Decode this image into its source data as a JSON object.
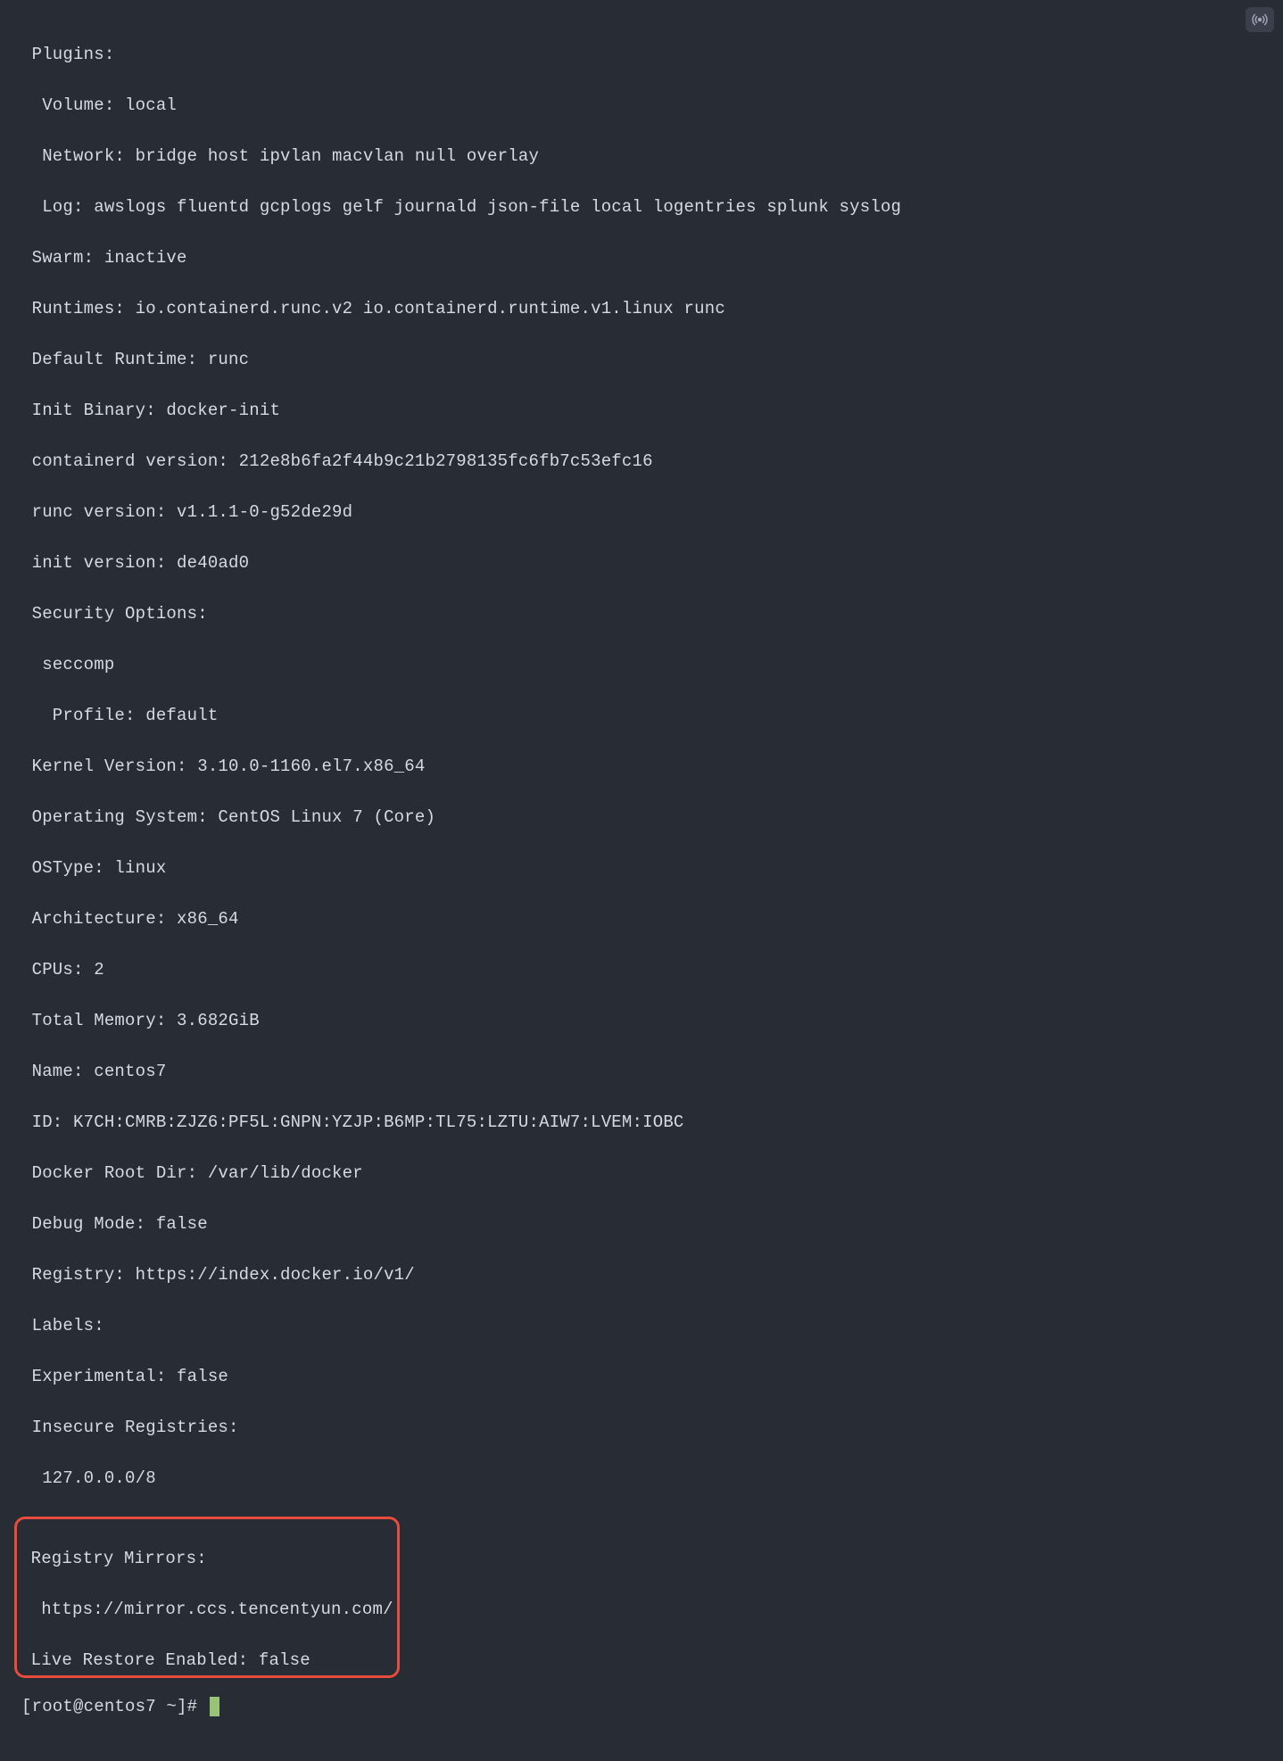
{
  "terminal": {
    "lines": [
      " Plugins:",
      "  Volume: local",
      "  Network: bridge host ipvlan macvlan null overlay",
      "  Log: awslogs fluentd gcplogs gelf journald json-file local logentries splunk syslog",
      " Swarm: inactive",
      " Runtimes: io.containerd.runc.v2 io.containerd.runtime.v1.linux runc",
      " Default Runtime: runc",
      " Init Binary: docker-init",
      " containerd version: 212e8b6fa2f44b9c21b2798135fc6fb7c53efc16",
      " runc version: v1.1.1-0-g52de29d",
      " init version: de40ad0",
      " Security Options:",
      "  seccomp",
      "   Profile: default",
      " Kernel Version: 3.10.0-1160.el7.x86_64",
      " Operating System: CentOS Linux 7 (Core)",
      " OSType: linux",
      " Architecture: x86_64",
      " CPUs: 2",
      " Total Memory: 3.682GiB",
      " Name: centos7",
      " ID: K7CH:CMRB:ZJZ6:PF5L:GNPN:YZJP:B6MP:TL75:LZTU:AIW7:LVEM:IOBC",
      " Docker Root Dir: /var/lib/docker",
      " Debug Mode: false",
      " Registry: https://index.docker.io/v1/",
      " Labels:",
      " Experimental: false",
      " Insecure Registries:",
      "  127.0.0.0/8"
    ],
    "highlighted": [
      " Registry Mirrors:",
      "  https://mirror.ccs.tencentyun.com/",
      " Live Restore Enabled: false"
    ],
    "prompt": "[root@centos7 ~]# "
  }
}
